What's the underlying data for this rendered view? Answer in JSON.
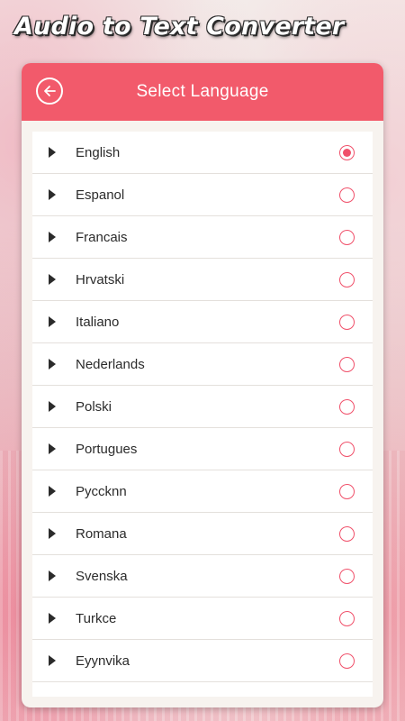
{
  "app": {
    "title": "Audio to Text Converter"
  },
  "header": {
    "title": "Select Language"
  },
  "colors": {
    "accent": "#f25a6b",
    "radio": "#f0506a"
  },
  "languages": [
    {
      "label": "English",
      "selected": true
    },
    {
      "label": "Espanol",
      "selected": false
    },
    {
      "label": "Francais",
      "selected": false
    },
    {
      "label": "Hrvatski",
      "selected": false
    },
    {
      "label": "Italiano",
      "selected": false
    },
    {
      "label": "Nederlands",
      "selected": false
    },
    {
      "label": "Polski",
      "selected": false
    },
    {
      "label": "Portugues",
      "selected": false
    },
    {
      "label": "Pyccknn",
      "selected": false
    },
    {
      "label": "Romana",
      "selected": false
    },
    {
      "label": "Svenska",
      "selected": false
    },
    {
      "label": "Turkce",
      "selected": false
    },
    {
      "label": "Eyynvika",
      "selected": false
    }
  ]
}
